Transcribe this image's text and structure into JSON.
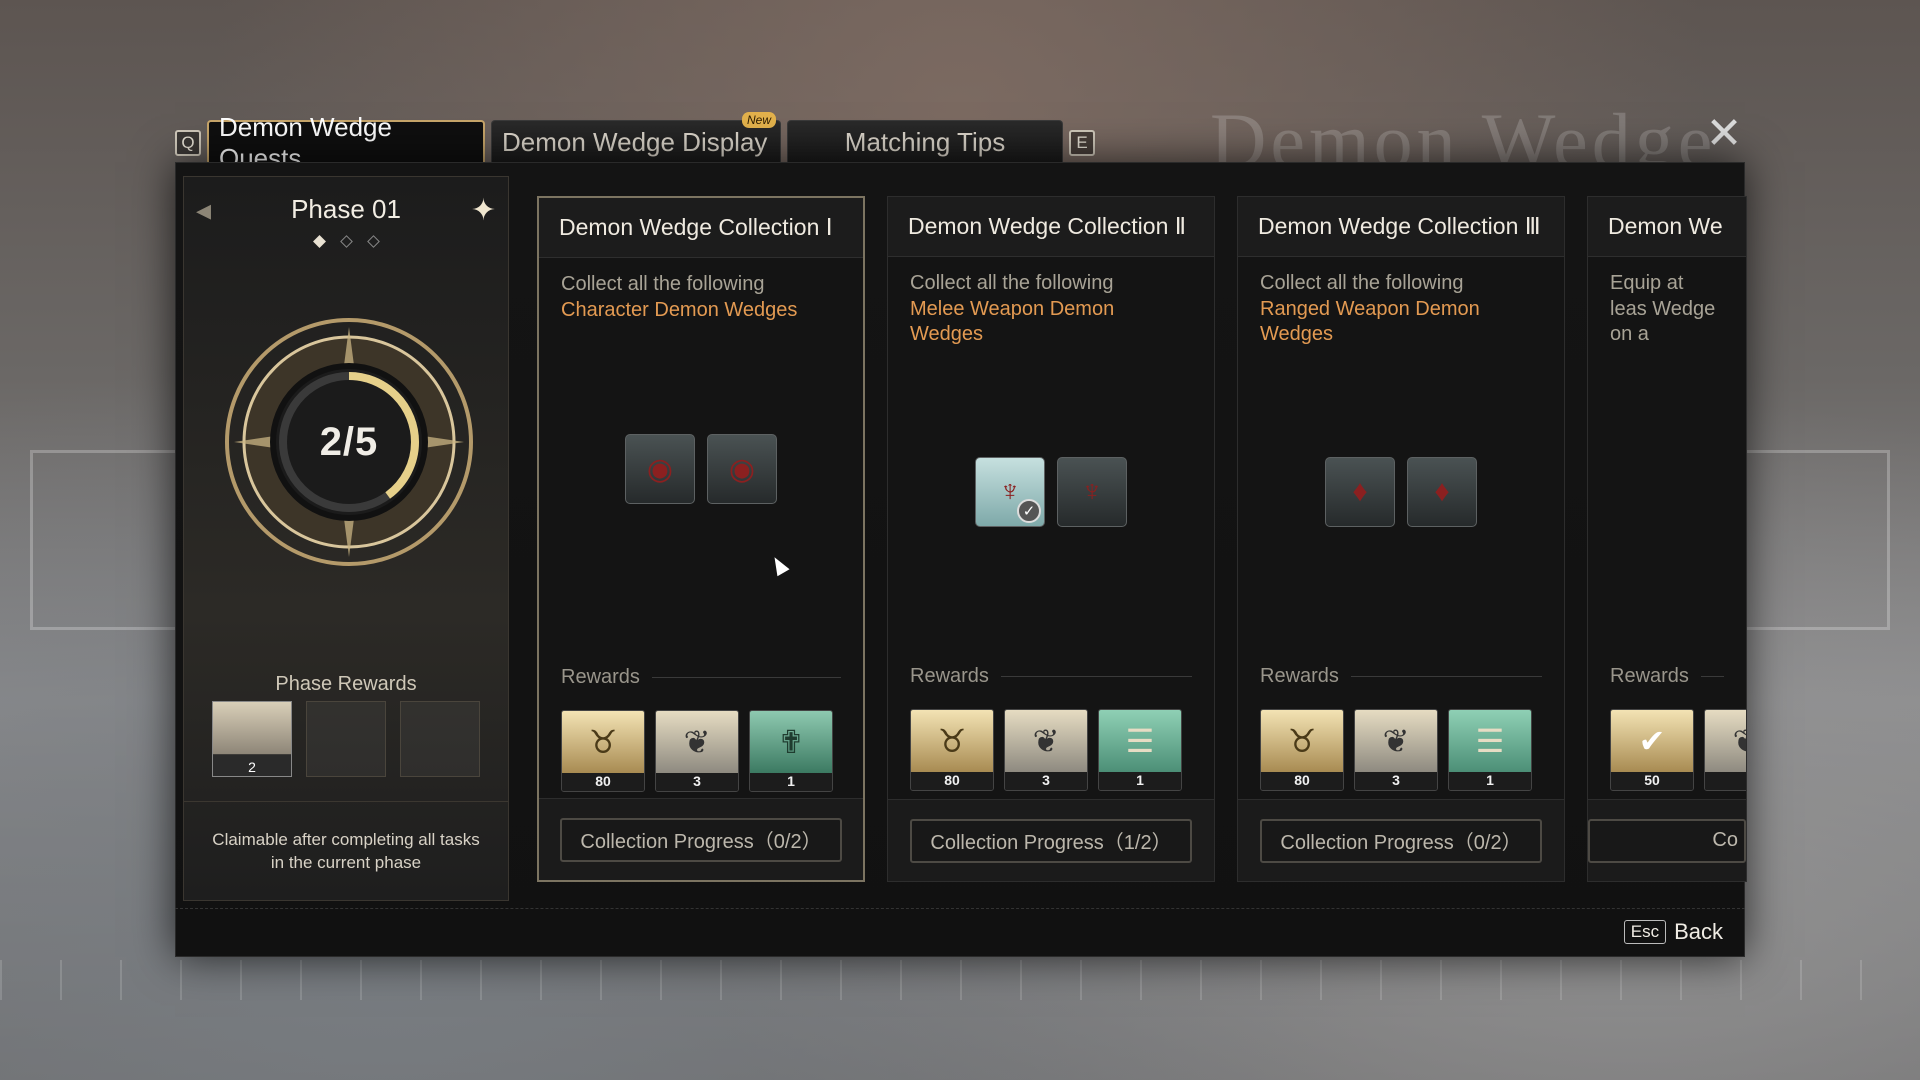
{
  "background_title": "Demon Wedge Casket",
  "tabs": {
    "left_key": "Q",
    "right_key": "E",
    "items": [
      {
        "label": "Demon Wedge Quests"
      },
      {
        "label": "Demon Wedge Display",
        "badge": "New"
      },
      {
        "label": "Matching Tips"
      }
    ]
  },
  "close_icon": "close-icon",
  "phase": {
    "title": "Phase 01",
    "progress_text": "2/5",
    "progress": {
      "current": 2,
      "total": 5
    },
    "rewards_label": "Phase Rewards",
    "rewards": [
      {
        "count": "2",
        "icon": "feather-icon"
      }
    ],
    "footer": "Claimable after completing all tasks in the current phase"
  },
  "cards": [
    {
      "title": "Demon Wedge Collection Ⅰ",
      "desc": "Collect all the following",
      "highlight": "Character Demon Wedges",
      "wedges": [
        {
          "icon": "character-wedge-icon",
          "collected": false
        },
        {
          "icon": "character-wedge-icon",
          "collected": false
        }
      ],
      "rewards_label": "Rewards",
      "rewards": [
        {
          "count": "80",
          "icon": "gold-emblem-icon"
        },
        {
          "count": "3",
          "icon": "feather-icon"
        },
        {
          "count": "1",
          "icon": "book-icon"
        }
      ],
      "progress_text": "Collection Progress（0/2）"
    },
    {
      "title": "Demon Wedge Collection Ⅱ",
      "desc": "Collect all the following",
      "highlight": "Melee Weapon Demon Wedges",
      "wedges": [
        {
          "icon": "melee-wedge-icon",
          "collected": true
        },
        {
          "icon": "melee-wedge-icon",
          "collected": false
        }
      ],
      "rewards_label": "Rewards",
      "rewards": [
        {
          "count": "80",
          "icon": "gold-emblem-icon"
        },
        {
          "count": "3",
          "icon": "feather-icon"
        },
        {
          "count": "1",
          "icon": "scroll-icon"
        }
      ],
      "progress_text": "Collection Progress（1/2）"
    },
    {
      "title": "Demon Wedge Collection Ⅲ",
      "desc": "Collect all the following",
      "highlight": "Ranged Weapon Demon Wedges",
      "wedges": [
        {
          "icon": "ranged-wedge-icon",
          "collected": false
        },
        {
          "icon": "ranged-wedge-icon",
          "collected": false
        }
      ],
      "rewards_label": "Rewards",
      "rewards": [
        {
          "count": "80",
          "icon": "gold-emblem-icon"
        },
        {
          "count": "3",
          "icon": "feather-icon"
        },
        {
          "count": "1",
          "icon": "scroll-icon"
        }
      ],
      "progress_text": "Collection Progress（0/2）"
    },
    {
      "title": "Demon We",
      "desc": "Equip at leas Wedge on a",
      "rewards_label": "Rewards",
      "rewards": [
        {
          "count": "50",
          "icon": "gold-emblem-icon",
          "claimed": true
        }
      ],
      "progress_text": "Co"
    }
  ],
  "footer": {
    "esc_key": "Esc",
    "back_label": "Back"
  }
}
